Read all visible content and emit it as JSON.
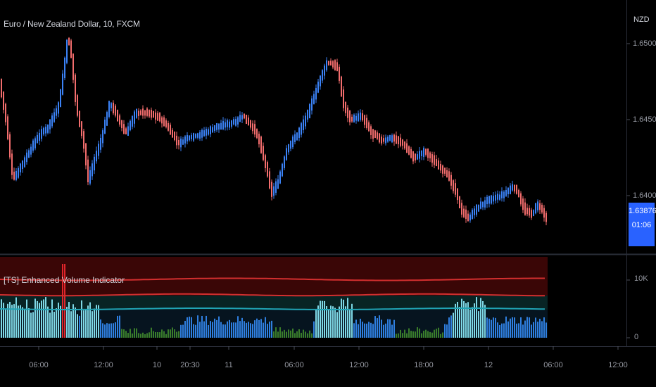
{
  "header": {
    "symbol_title": "Euro / New Zealand Dollar, 10, FXCM"
  },
  "price_axis": {
    "currency": "NZD",
    "labels": [
      "1.65000",
      "1.64500",
      "1.64000"
    ],
    "last_price": "1.63876",
    "countdown": "01:06",
    "last_price_color": "#2962ff"
  },
  "indicator": {
    "title": "[TS] Enhanced Volume Indicator",
    "axis_labels": [
      "10K",
      "0"
    ]
  },
  "time_axis": {
    "labels": [
      "06:00",
      "12:00",
      "10",
      "20:30",
      "11",
      "06:00",
      "12:00",
      "18:00",
      "12",
      "06:00",
      "12:00"
    ]
  },
  "colors": {
    "background": "#000000",
    "candle_up": "#3b82f6",
    "candle_down": "#f26d6d",
    "volume_high": "#7fd8e6",
    "volume_mid": "#2f7fe0",
    "volume_low": "#3a7d2a",
    "volume_spike": "#e0242a",
    "upper_band": "#d32f2f",
    "mid_band": "#20a4b4"
  }
}
